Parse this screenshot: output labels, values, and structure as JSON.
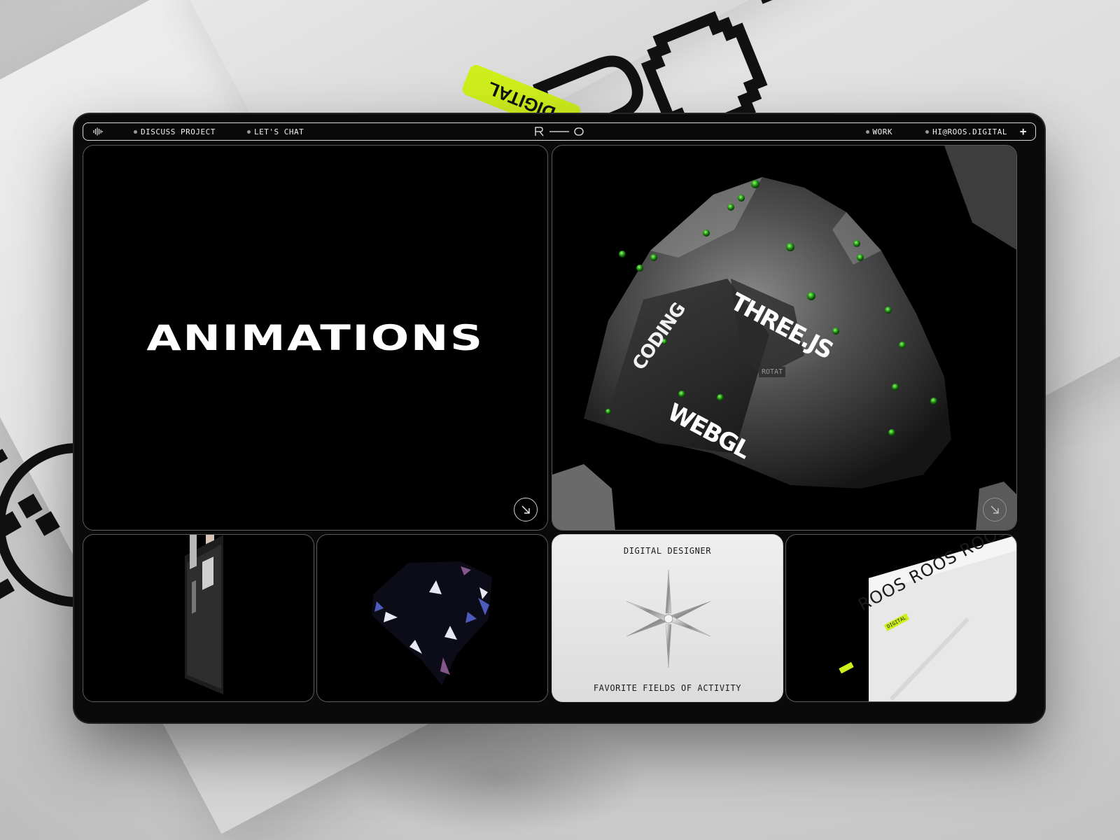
{
  "nav": {
    "left_items": [
      {
        "label": "DISCUSS PROJECT"
      },
      {
        "label": "LET'S CHAT"
      }
    ],
    "logo_text": "R—O",
    "right_items": [
      {
        "label": "WORK"
      },
      {
        "label": "HI@ROOS.DIGITAL"
      }
    ],
    "plus_icon": "plus-icon",
    "wave_icon": "sound-wave-icon"
  },
  "hero": {
    "title": "ANIMATIONS",
    "arrow_icon": "arrow-down-right-icon"
  },
  "rock_card": {
    "words": [
      "CODING",
      "THREE.JS",
      "WEBGL",
      "ROTAT"
    ],
    "arrow_icon": "arrow-down-right-icon"
  },
  "fields_card": {
    "top_label": "DIGITAL DESIGNER",
    "bottom_label": "FAVORITE FIELDS OF ACTIVITY",
    "icon": "star-icon"
  },
  "roos_card": {
    "ribbon_text": "ROOS ROOS ROOS",
    "tag_text": "DIGITAL"
  },
  "background": {
    "brand_text": "ROOS",
    "tag_text": "DIGITAL",
    "accent": "#cfef1c"
  }
}
